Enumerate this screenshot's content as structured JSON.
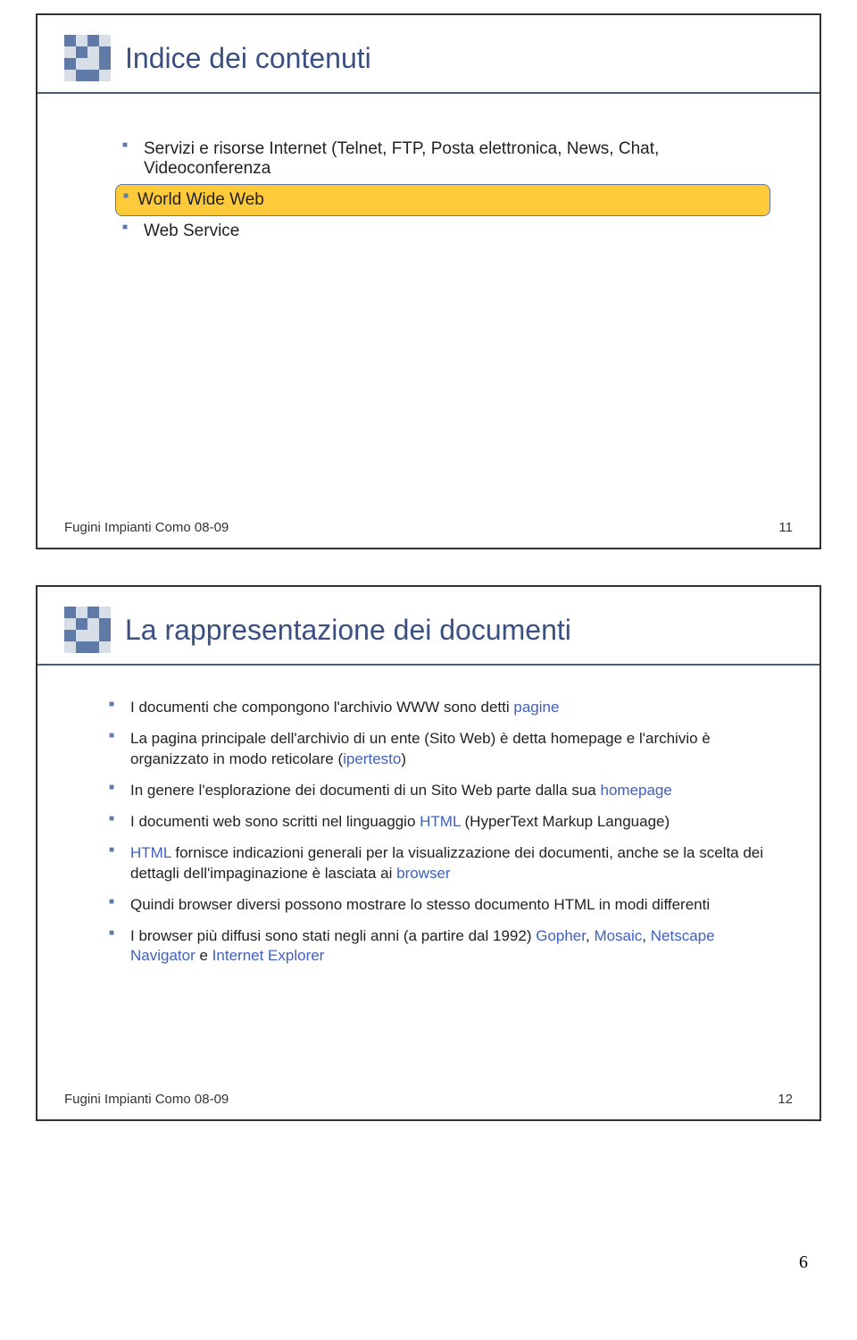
{
  "slide1": {
    "title": "Indice dei contenuti",
    "items": [
      {
        "text": "Servizi e risorse Internet (Telnet, FTP, Posta elettronica, News, Chat, Videoconferenza",
        "highlight": false
      },
      {
        "text": "World Wide Web",
        "highlight": true
      },
      {
        "text": "Web Service",
        "highlight": false
      }
    ],
    "footer_left": "Fugini Impianti Como 08-09",
    "footer_right": "11"
  },
  "slide2": {
    "title": "La rappresentazione dei documenti",
    "items": [
      {
        "parts": [
          {
            "t": "I documenti che compongono l'archivio WWW sono detti "
          },
          {
            "t": "pagine",
            "c": "blue"
          }
        ]
      },
      {
        "parts": [
          {
            "t": "La pagina principale dell'archivio di un ente (Sito Web) è detta homepage e l'archivio è organizzato in modo reticolare ("
          },
          {
            "t": "ipertesto",
            "c": "blue"
          },
          {
            "t": ")"
          }
        ]
      },
      {
        "parts": [
          {
            "t": "In genere l'esplorazione dei documenti di un Sito Web parte dalla sua "
          },
          {
            "t": "homepage",
            "c": "blue"
          }
        ]
      },
      {
        "parts": [
          {
            "t": "I documenti web sono scritti nel linguaggio "
          },
          {
            "t": "HTML",
            "c": "blue"
          },
          {
            "t": " (HyperText Markup Language)"
          }
        ]
      },
      {
        "parts": [
          {
            "t": "HTML",
            "c": "blue"
          },
          {
            "t": " fornisce indicazioni generali per la visualizzazione dei documenti, anche se la scelta dei dettagli dell'impaginazione è lasciata ai "
          },
          {
            "t": "browser",
            "c": "blue"
          }
        ]
      },
      {
        "parts": [
          {
            "t": "Quindi browser diversi possono mostrare lo stesso documento HTML in modi differenti"
          }
        ]
      },
      {
        "parts": [
          {
            "t": "I browser più diffusi sono stati negli anni (a partire dal 1992) "
          },
          {
            "t": "Gopher",
            "c": "blue"
          },
          {
            "t": ", "
          },
          {
            "t": "Mosaic",
            "c": "blue"
          },
          {
            "t": ", "
          },
          {
            "t": "Netscape Navigator",
            "c": "blue"
          },
          {
            "t": " e "
          },
          {
            "t": "Internet Explorer",
            "c": "blue"
          }
        ]
      }
    ],
    "footer_left": "Fugini Impianti Como 08-09",
    "footer_right": "12"
  },
  "page_number": "6"
}
